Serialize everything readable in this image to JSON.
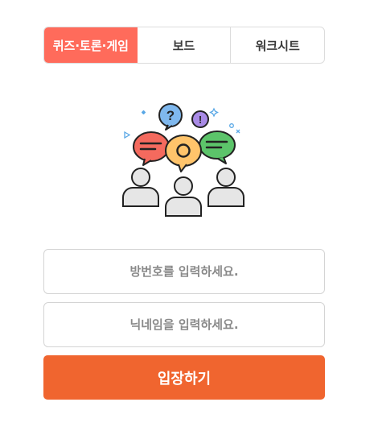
{
  "tabs": [
    {
      "label": "퀴즈·토론·게임",
      "active": true
    },
    {
      "label": "보드",
      "active": false
    },
    {
      "label": "워크시트",
      "active": false
    }
  ],
  "illustration": {
    "icon": "discussion-people-illustration",
    "bubble_marks": {
      "question": "?",
      "exclamation": "!"
    }
  },
  "form": {
    "room_number": {
      "value": "",
      "placeholder": "방번호를 입력하세요."
    },
    "nickname": {
      "value": "",
      "placeholder": "닉네임을 입력하세요."
    },
    "enter_label": "입장하기"
  },
  "colors": {
    "active_tab": "#ff6b5b",
    "enter_button": "#f0652f",
    "bubble_red": "#f46a5e",
    "bubble_yellow": "#ffc46b",
    "bubble_green": "#5cc46a",
    "bubble_blue": "#7fb8ee",
    "bubble_purple": "#a98be6"
  }
}
